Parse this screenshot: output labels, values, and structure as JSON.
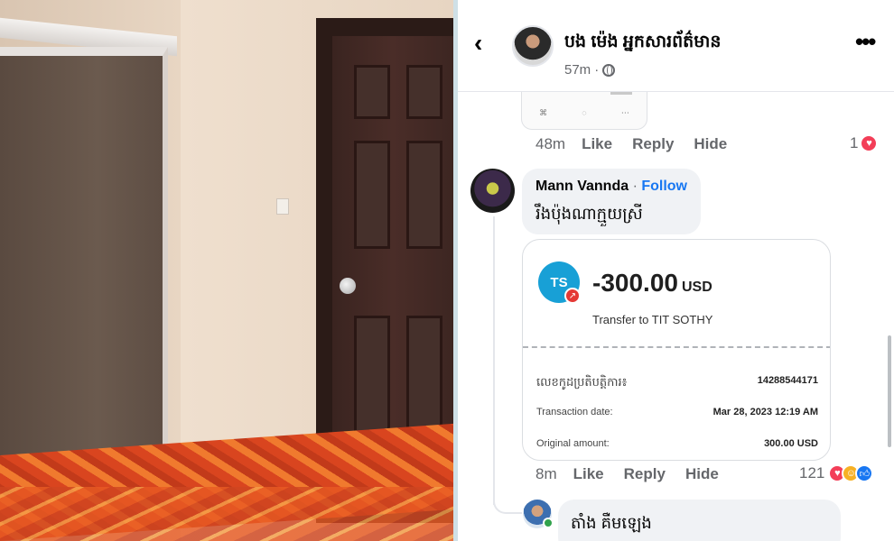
{
  "post": {
    "page_name": "បង ម៉េង អ្នកសារព័ត៌មាន",
    "time": "57m",
    "privacy_icon": "globe-icon",
    "back_icon": "back-arrow-icon",
    "more_icon": "more-options-icon"
  },
  "prev_comment": {
    "time": "48m",
    "like": "Like",
    "reply": "Reply",
    "hide": "Hide",
    "reaction_count": "1"
  },
  "comment1": {
    "author": "Mann Vannda",
    "separator": " · ",
    "follow": "Follow",
    "text": "រឹងប៉ុងណាក្មួយស្រី",
    "time": "8m",
    "like": "Like",
    "reply": "Reply",
    "hide": "Hide",
    "reaction_count": "121"
  },
  "receipt": {
    "badge": "TS",
    "amount": "-300.00",
    "currency": "USD",
    "transfer_to": "Transfer to TIT SOTHY",
    "rows": [
      {
        "label": "លេខកូដប្រតិបត្តិការ៖",
        "value": "14288544171"
      },
      {
        "label": "Transaction date:",
        "value": "Mar 28, 2023 12:19 AM"
      },
      {
        "label": "Original amount:",
        "value": "300.00 USD"
      }
    ]
  },
  "comment2": {
    "text": "តាំង គឺមឡេង"
  },
  "colors": {
    "accent": "#1877f2",
    "badge": "#18a0d6",
    "heart": "#f33e58",
    "online": "#31a24c"
  }
}
